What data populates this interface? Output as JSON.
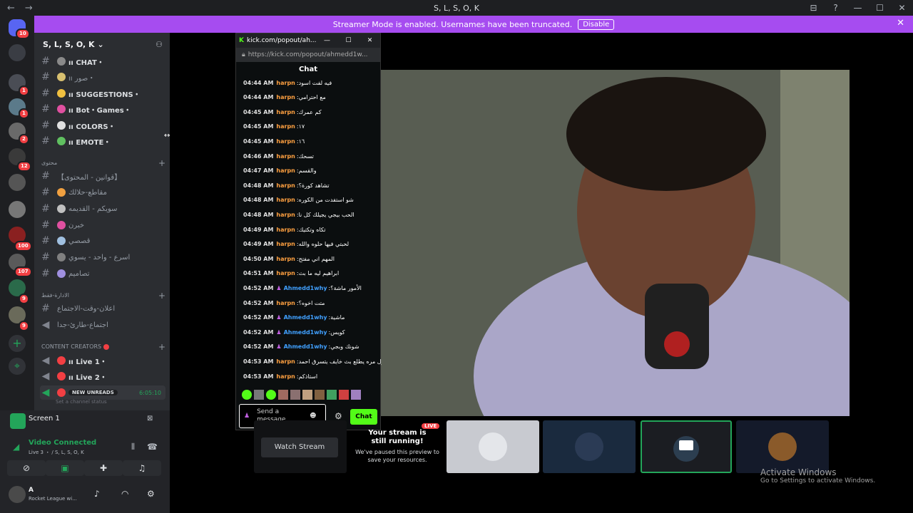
{
  "window": {
    "title": "S, L, S, O, K",
    "nav_back": "←",
    "nav_forward": "→"
  },
  "window_controls": [
    "⊟",
    "?",
    "—",
    "☐",
    "✕"
  ],
  "banner": {
    "text": "Streamer Mode is enabled. Usernames have been truncated.",
    "button": "Disable",
    "close": "✕",
    "color": "#a64cf0"
  },
  "server_list": {
    "badges": [
      "10",
      "1",
      "1",
      "2",
      "12",
      "100",
      "107",
      "9",
      "9"
    ],
    "add_server": "+",
    "discover": "⌖"
  },
  "sidebar": {
    "server_name": "S, L, S, O, K",
    "channels": [
      {
        "prefix": "# ",
        "label": "ıı CHAT・",
        "emoji": "#8a8a8a"
      },
      {
        "prefix": "# ",
        "label": "ıı صور・",
        "emoji": "#d8c070"
      },
      {
        "prefix": "# ",
        "label": "ıı SUGGESTIONS・",
        "emoji": "#f0c040"
      },
      {
        "prefix": "# ",
        "label": "ıı Bot・Games・",
        "emoji": "#e050a0"
      },
      {
        "prefix": "# ",
        "label": "ıı COLORS・",
        "emoji": "#e0e0e0"
      },
      {
        "prefix": "# ",
        "label": "ıı EMOTE・",
        "emoji": "#60c060"
      }
    ],
    "category_content": "محتوى",
    "content_channels": [
      {
        "label": "【قوانين - المحتوى】",
        "emoji": "#2b2d31"
      },
      {
        "label": "مقاطع-حلالك",
        "emoji": "#f0a040"
      },
      {
        "label": "سويكم - القديمه",
        "emoji": "#c0c0c0"
      },
      {
        "label": "خبرن",
        "emoji": "#e050a0"
      },
      {
        "label": "قصصي",
        "emoji": "#a0c0e0"
      },
      {
        "label": "اسرع - واحد - يسوي",
        "emoji": "#808080"
      },
      {
        "label": "تصاميم",
        "emoji": "#a090e0"
      }
    ],
    "category_admin": "الادارة-فقط",
    "admin_channels": [
      "اعلان-وقت-الاجتماع",
      "اجتماع-طارئ-جدا"
    ],
    "category_creators": "CONTENT CREATORS",
    "creator_channels": [
      "ıı Live 1・",
      "ıı Live 2・"
    ],
    "new_unreads": "NEW UNREADS",
    "status_time": "6:05:10",
    "status_placeholder": "Set a channel status"
  },
  "screen_share": {
    "label": "Screen 1"
  },
  "voice": {
    "status": "Video Connected",
    "location": "Live 3 ・ / S, L, S, O, K"
  },
  "user": {
    "name": "A",
    "activity": "Rocket League wi..."
  },
  "popout": {
    "title": "kick.com/popout/ah...",
    "url": "https://kick.com/popout/ahmedd1w...",
    "header": "Chat",
    "messages": [
      {
        "time": "04:44 AM",
        "user": "harpn",
        "text": "فيه لفت اسود",
        "color": "#ffa040"
      },
      {
        "time": "04:44 AM",
        "user": "harpn",
        "text": "مع احترامي",
        "color": "#ffa040"
      },
      {
        "time": "04:45 AM",
        "user": "harpn",
        "text": "كم عمرك",
        "color": "#ffa040"
      },
      {
        "time": "04:45 AM",
        "user": "harpn",
        "text": "١٧",
        "color": "#ffa040"
      },
      {
        "time": "04:45 AM",
        "user": "harpn",
        "text": "١٦",
        "color": "#ffa040"
      },
      {
        "time": "04:46 AM",
        "user": "harpn",
        "text": "تسحك",
        "color": "#ffa040"
      },
      {
        "time": "04:47 AM",
        "user": "harpn",
        "text": "والقسم",
        "color": "#ffa040"
      },
      {
        "time": "04:48 AM",
        "user": "harpn",
        "text": "تشاهد كورة؟",
        "color": "#ffa040"
      },
      {
        "time": "04:48 AM",
        "user": "harpn",
        "text": "شو استفدت من الكوره",
        "color": "#ffa040"
      },
      {
        "time": "04:48 AM",
        "user": "harpn",
        "text": "الحب بيجي يجيلك كل نا",
        "color": "#ffa040"
      },
      {
        "time": "04:49 AM",
        "user": "harpn",
        "text": "تكاه وتكتيك",
        "color": "#ffa040"
      },
      {
        "time": "04:49 AM",
        "user": "harpn",
        "text": "لحبتي فيها حلوه والله",
        "color": "#ffa040"
      },
      {
        "time": "04:50 AM",
        "user": "harpn",
        "text": "المهم اني مفتح",
        "color": "#ffa040"
      },
      {
        "time": "04:51 AM",
        "user": "harpn",
        "text": "ابراهيم ليه ما بث",
        "color": "#ffa040"
      },
      {
        "time": "04:52 AM",
        "user": "Ahmedd1why",
        "text": "الأمور ماشة؟",
        "color": "#40a0ff"
      },
      {
        "time": "04:52 AM",
        "user": "harpn",
        "text": "متت اخوه؟",
        "color": "#ffa040"
      },
      {
        "time": "04:52 AM",
        "user": "Ahmedd1why",
        "text": "ماشية",
        "color": "#40a0ff"
      },
      {
        "time": "04:52 AM",
        "user": "Ahmedd1why",
        "text": "كويس",
        "color": "#40a0ff"
      },
      {
        "time": "04:52 AM",
        "user": "Ahmedd1why",
        "text": "شونك وبجي",
        "color": "#40a0ff"
      },
      {
        "time": "04:53 AM",
        "user": "harpn",
        "text": "اول مره يطلع بث خايف يتسرق احمد",
        "color": "#ffa040"
      },
      {
        "time": "04:53 AM",
        "user": "harpn",
        "text": "استاذكم",
        "color": "#ffa040"
      }
    ],
    "input_placeholder": "Send a message",
    "chat_button": "Chat"
  },
  "preview": {
    "live_badge": "LIVE",
    "paused_title": "Your stream is still running!",
    "paused_desc": "We've paused this preview to save your resources.",
    "watch": "Watch Stream"
  },
  "activate": {
    "title": "Activate Windows",
    "desc": "Go to Settings to activate Windows."
  }
}
